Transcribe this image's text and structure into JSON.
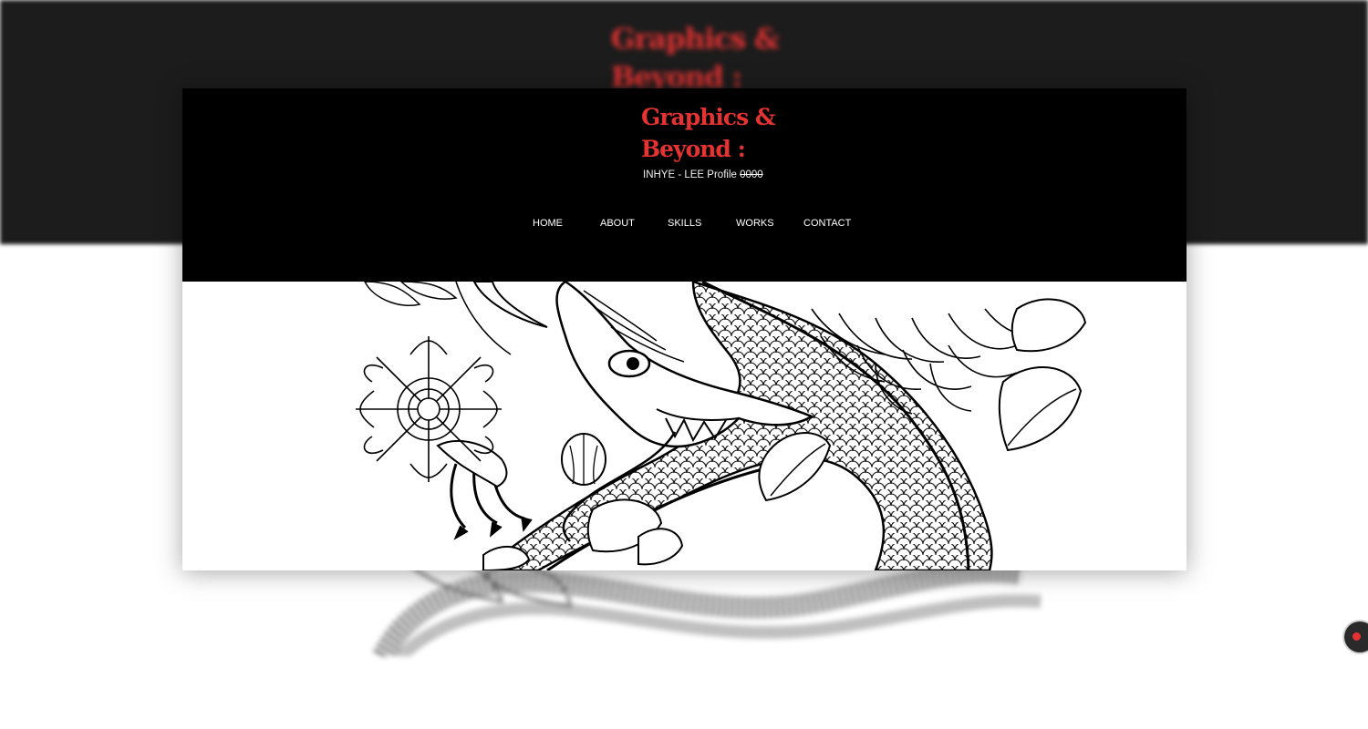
{
  "site": {
    "title": "Graphics &\nBeyond :",
    "subtitle_text": "INHYE - LEE Profile ",
    "subtitle_struck": "0000"
  },
  "nav": {
    "items": [
      {
        "label": "HOME"
      },
      {
        "label": "ABOUT"
      },
      {
        "label": "SKILLS"
      },
      {
        "label": "WORKS"
      },
      {
        "label": "CONTACT"
      }
    ]
  },
  "hero": {
    "image_icon": "dragon-chrysanthemum-illustration-icon"
  },
  "floating_button": {
    "icon": "chat-icon"
  },
  "colors": {
    "accent": "#e53232",
    "header_bg": "#000000",
    "backdrop_band": "#1c1c1c",
    "nav_text": "#ffffff"
  }
}
